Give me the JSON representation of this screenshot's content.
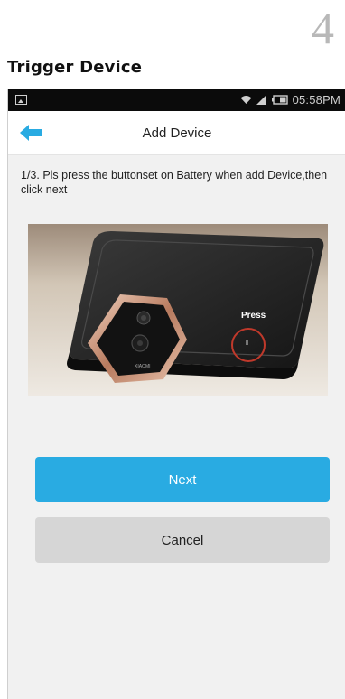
{
  "manual": {
    "step_number": "4",
    "heading": "Trigger Device"
  },
  "status_bar": {
    "time": "05:58PM",
    "icons": [
      "image-notification-icon",
      "wifi-icon",
      "signal-icon",
      "battery-icon"
    ]
  },
  "header": {
    "back_icon": "arrow-left-icon",
    "title": "Add Device"
  },
  "content": {
    "instruction": "1/3. Pls press the buttonset on Battery when add Device,then click next",
    "photo_label": "Press",
    "doorbell_brand": "XIAOMI"
  },
  "actions": {
    "next_label": "Next",
    "cancel_label": "Cancel"
  },
  "colors": {
    "accent": "#29abe2",
    "cancel_bg": "#d6d6d6",
    "highlight_circle": "#c0392b",
    "doorbell_frame": "#c8927a"
  }
}
